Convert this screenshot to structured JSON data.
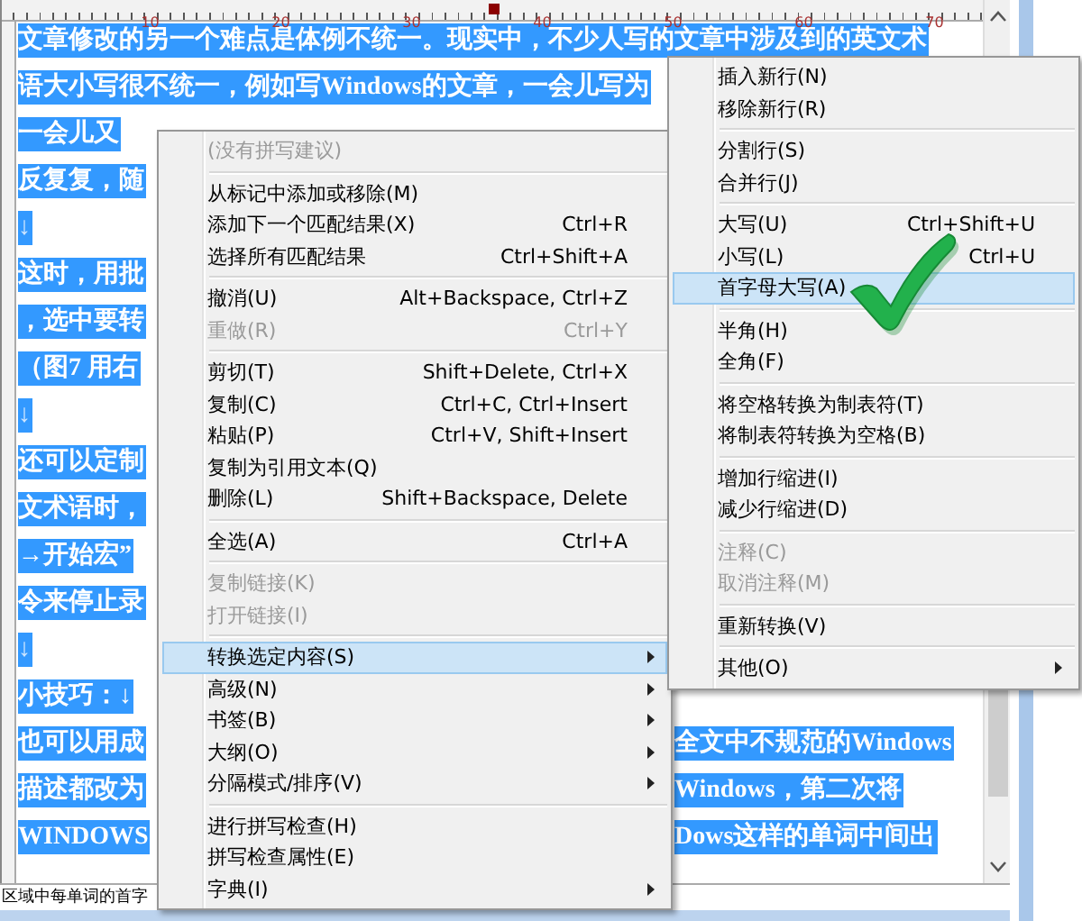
{
  "ruler": {
    "labels": [
      "10",
      "20",
      "30",
      "40",
      "50",
      "60",
      "70"
    ]
  },
  "document": {
    "lines": [
      {
        "kind": "text",
        "left": "文章修改的另一个难点是体例不统一。现实中，不少人写的文章中涉及到的英文术",
        "selected": true
      },
      {
        "kind": "text",
        "left": "语大小写很不统一，例如写Windows的文章，一会儿写为",
        "selected": true
      },
      {
        "kind": "text",
        "left": "一会儿又",
        "selected": true
      },
      {
        "kind": "text",
        "left": "反复复，随",
        "selected": true
      },
      {
        "kind": "mark",
        "left": "↓",
        "selected": true
      },
      {
        "kind": "text",
        "left": "这时，用批",
        "selected": true
      },
      {
        "kind": "text",
        "left": "，选中要转",
        "selected": true
      },
      {
        "kind": "text",
        "left": "（图7  用右",
        "selected": true
      },
      {
        "kind": "mark",
        "left": "↓",
        "selected": true
      },
      {
        "kind": "text",
        "left": "还可以定制",
        "selected": true
      },
      {
        "kind": "text",
        "left": "文术语时，",
        "selected": true
      },
      {
        "kind": "text",
        "left": "→开始宏”",
        "selected": true
      },
      {
        "kind": "text",
        "left": "令来停止录",
        "selected": true
      },
      {
        "kind": "mark",
        "left": "↓",
        "selected": true
      },
      {
        "kind": "text",
        "left": "小技巧：↓",
        "selected": true
      },
      {
        "kind": "text",
        "left": "也可以用成",
        "right": "全文中不规范的Windows",
        "selected": true
      },
      {
        "kind": "text",
        "left": "描述都改为",
        "right": "Windows，第二次将",
        "selected": true
      },
      {
        "kind": "text",
        "left": "WINDOWS",
        "right": "Dows这样的单词中间出",
        "selected": true
      }
    ]
  },
  "context_menu": {
    "items": [
      {
        "kind": "item",
        "label": "(没有拼写建议)",
        "disabled": true,
        "selected": false,
        "has_submenu": false
      },
      {
        "kind": "separator"
      },
      {
        "kind": "item",
        "label": "从标记中添加或移除(M)",
        "disabled": false,
        "selected": false,
        "has_submenu": false
      },
      {
        "kind": "item",
        "label": "添加下一个匹配结果(X)",
        "shortcut": "Ctrl+R",
        "disabled": false,
        "selected": false,
        "has_submenu": false
      },
      {
        "kind": "item",
        "label": "选择所有匹配结果",
        "shortcut": "Ctrl+Shift+A",
        "disabled": false,
        "selected": false,
        "has_submenu": false
      },
      {
        "kind": "separator"
      },
      {
        "kind": "item",
        "label": "撤消(U)",
        "shortcut": "Alt+Backspace, Ctrl+Z",
        "disabled": false,
        "selected": false,
        "has_submenu": false
      },
      {
        "kind": "item",
        "label": "重做(R)",
        "shortcut": "Ctrl+Y",
        "disabled": true,
        "selected": false,
        "has_submenu": false
      },
      {
        "kind": "separator"
      },
      {
        "kind": "item",
        "label": "剪切(T)",
        "shortcut": "Shift+Delete, Ctrl+X",
        "disabled": false,
        "selected": false,
        "has_submenu": false
      },
      {
        "kind": "item",
        "label": "复制(C)",
        "shortcut": "Ctrl+C, Ctrl+Insert",
        "disabled": false,
        "selected": false,
        "has_submenu": false
      },
      {
        "kind": "item",
        "label": "粘贴(P)",
        "shortcut": "Ctrl+V, Shift+Insert",
        "disabled": false,
        "selected": false,
        "has_submenu": false
      },
      {
        "kind": "item",
        "label": "复制为引用文本(Q)",
        "disabled": false,
        "selected": false,
        "has_submenu": false
      },
      {
        "kind": "item",
        "label": "删除(L)",
        "shortcut": "Shift+Backspace, Delete",
        "disabled": false,
        "selected": false,
        "has_submenu": false
      },
      {
        "kind": "separator"
      },
      {
        "kind": "item",
        "label": "全选(A)",
        "shortcut": "Ctrl+A",
        "disabled": false,
        "selected": false,
        "has_submenu": false
      },
      {
        "kind": "separator"
      },
      {
        "kind": "item",
        "label": "复制链接(K)",
        "disabled": true,
        "selected": false,
        "has_submenu": false
      },
      {
        "kind": "item",
        "label": "打开链接(I)",
        "disabled": true,
        "selected": false,
        "has_submenu": false
      },
      {
        "kind": "separator"
      },
      {
        "kind": "item",
        "label": "转换选定内容(S)",
        "disabled": false,
        "selected": true,
        "has_submenu": true
      },
      {
        "kind": "item",
        "label": "高级(N)",
        "disabled": false,
        "selected": false,
        "has_submenu": true
      },
      {
        "kind": "item",
        "label": "书签(B)",
        "disabled": false,
        "selected": false,
        "has_submenu": true
      },
      {
        "kind": "item",
        "label": "大纲(O)",
        "disabled": false,
        "selected": false,
        "has_submenu": true
      },
      {
        "kind": "item",
        "label": "分隔模式/排序(V)",
        "disabled": false,
        "selected": false,
        "has_submenu": true
      },
      {
        "kind": "separator"
      },
      {
        "kind": "item",
        "label": "进行拼写检查(H)",
        "disabled": false,
        "selected": false,
        "has_submenu": false
      },
      {
        "kind": "item",
        "label": "拼写检查属性(E)",
        "disabled": false,
        "selected": false,
        "has_submenu": false
      },
      {
        "kind": "item",
        "label": "字典(I)",
        "disabled": false,
        "selected": false,
        "has_submenu": true
      }
    ]
  },
  "submenu": {
    "items": [
      {
        "kind": "item",
        "label": "插入新行(N)",
        "disabled": false,
        "selected": false,
        "has_submenu": false
      },
      {
        "kind": "item",
        "label": "移除新行(R)",
        "disabled": false,
        "selected": false,
        "has_submenu": false
      },
      {
        "kind": "separator"
      },
      {
        "kind": "item",
        "label": "分割行(S)",
        "disabled": false,
        "selected": false,
        "has_submenu": false
      },
      {
        "kind": "item",
        "label": "合并行(J)",
        "disabled": false,
        "selected": false,
        "has_submenu": false
      },
      {
        "kind": "separator"
      },
      {
        "kind": "item",
        "label": "大写(U)",
        "shortcut": "Ctrl+Shift+U",
        "disabled": false,
        "selected": false,
        "has_submenu": false
      },
      {
        "kind": "item",
        "label": "小写(L)",
        "shortcut": "Ctrl+U",
        "disabled": false,
        "selected": false,
        "has_submenu": false
      },
      {
        "kind": "item",
        "label": "首字母大写(A)",
        "disabled": false,
        "selected": true,
        "has_submenu": false
      },
      {
        "kind": "separator"
      },
      {
        "kind": "item",
        "label": "半角(H)",
        "disabled": false,
        "selected": false,
        "has_submenu": false
      },
      {
        "kind": "item",
        "label": "全角(F)",
        "disabled": false,
        "selected": false,
        "has_submenu": false
      },
      {
        "kind": "separator"
      },
      {
        "kind": "item",
        "label": "将空格转换为制表符(T)",
        "disabled": false,
        "selected": false,
        "has_submenu": false
      },
      {
        "kind": "item",
        "label": "将制表符转换为空格(B)",
        "disabled": false,
        "selected": false,
        "has_submenu": false
      },
      {
        "kind": "separator"
      },
      {
        "kind": "item",
        "label": "增加行缩进(I)",
        "disabled": false,
        "selected": false,
        "has_submenu": false
      },
      {
        "kind": "item",
        "label": "减少行缩进(D)",
        "disabled": false,
        "selected": false,
        "has_submenu": false
      },
      {
        "kind": "separator"
      },
      {
        "kind": "item",
        "label": "注释(C)",
        "disabled": true,
        "selected": false,
        "has_submenu": false
      },
      {
        "kind": "item",
        "label": "取消注释(M)",
        "disabled": true,
        "selected": false,
        "has_submenu": false
      },
      {
        "kind": "separator"
      },
      {
        "kind": "item",
        "label": "重新转换(V)",
        "disabled": false,
        "selected": false,
        "has_submenu": false
      },
      {
        "kind": "separator"
      },
      {
        "kind": "item",
        "label": "其他(O)",
        "disabled": false,
        "selected": false,
        "has_submenu": true
      }
    ]
  },
  "status_bar": {
    "text": "区域中每单词的首字"
  }
}
